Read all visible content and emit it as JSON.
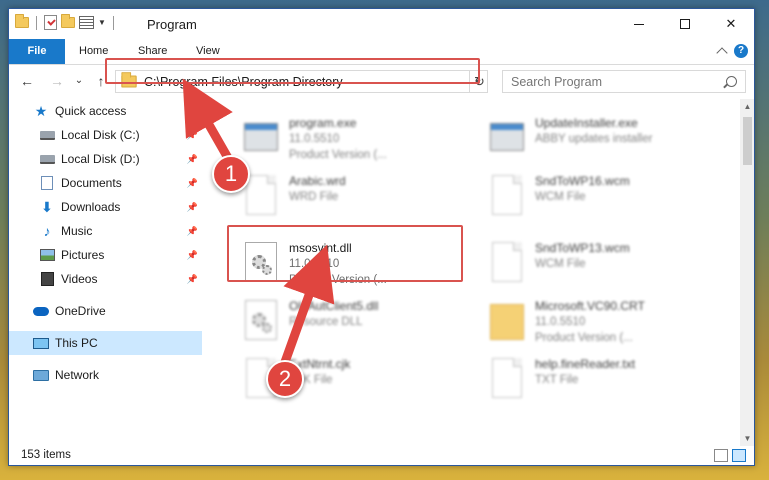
{
  "window": {
    "title": "Program",
    "controls": {
      "minimize": "",
      "maximize": "",
      "close": "✕"
    }
  },
  "ribbon": {
    "tabs": [
      "File",
      "Home",
      "Share",
      "View"
    ],
    "help": "?"
  },
  "nav": {
    "back": "←",
    "forward": "→",
    "recent": "⌄",
    "up": "↑",
    "address": "C:\\Program Files\\Program Directory",
    "refresh": "↻",
    "search_placeholder": "Search Program"
  },
  "sidebar": {
    "items": [
      {
        "label": "Quick access",
        "icon": "star-icon"
      },
      {
        "label": "Local Disk (C:)",
        "icon": "disk-icon",
        "pinned": true
      },
      {
        "label": "Local Disk (D:)",
        "icon": "disk-icon",
        "pinned": true
      },
      {
        "label": "Documents",
        "icon": "documents-icon",
        "pinned": true
      },
      {
        "label": "Downloads",
        "icon": "downloads-icon",
        "pinned": true
      },
      {
        "label": "Music",
        "icon": "music-icon",
        "pinned": true
      },
      {
        "label": "Pictures",
        "icon": "pictures-icon",
        "pinned": true
      },
      {
        "label": "Videos",
        "icon": "videos-icon",
        "pinned": true
      },
      {
        "label": "OneDrive",
        "icon": "cloud-icon"
      },
      {
        "label": "This PC",
        "icon": "computer-icon",
        "selected": true
      },
      {
        "label": "Network",
        "icon": "network-icon"
      }
    ]
  },
  "files": [
    {
      "name": "program.exe",
      "line2": "11.0.5510",
      "line3": "Product Version (...",
      "blurred": true
    },
    {
      "name": "UpdateInstaller.exe",
      "line2": "ABBY updates installer",
      "line3": "",
      "blurred": true
    },
    {
      "name": "Arabic.wrd",
      "line2": "WRD File",
      "line3": "",
      "blurred": true
    },
    {
      "name": "SndToWP16.wcm",
      "line2": "WCM File",
      "line3": "",
      "blurred": true
    },
    {
      "name": "msosvint.dll",
      "line2": "11.0.5510",
      "line3": "Product Version    (...",
      "blurred": false
    },
    {
      "name": "SndToWP13.wcm",
      "line2": "WCM File",
      "line3": "",
      "blurred": true
    },
    {
      "name": "OleAutClient5.dll",
      "line2": "Resource DLL",
      "line3": "",
      "blurred": true
    },
    {
      "name": "Microsoft.VC90.CRT",
      "line2": "11.0.5510",
      "line3": "Product Version (...",
      "blurred": true
    },
    {
      "name": "ExtNtrnt.cjk",
      "line2": "CJK File",
      "line3": "",
      "blurred": true
    },
    {
      "name": "help.fineReader.txt",
      "line2": "TXT File",
      "line3": "",
      "blurred": true
    }
  ],
  "status": {
    "count": "153 items"
  },
  "annotations": {
    "step1": "1",
    "step2": "2"
  },
  "colors": {
    "accent": "#1979ca",
    "highlight": "#d9534f"
  }
}
